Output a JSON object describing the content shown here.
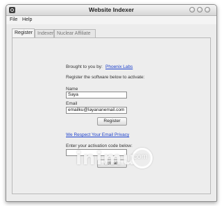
{
  "window": {
    "title": "Website Indexer"
  },
  "menu": {
    "items": [
      "File",
      "Help"
    ]
  },
  "tabs": [
    "Register",
    "Indexer",
    "Nuclear Affiliate"
  ],
  "register": {
    "brought_by_label": "Brought to you by:",
    "brought_by_link": "Phoenix Labs",
    "instructions": "Register the software below to activate:",
    "name_label": "Name",
    "name_value": "Saya",
    "email_label": "Email",
    "email_value": "emailku@layananemail.com",
    "register_button": "Register",
    "privacy_link": "We Respect Your Email Privacy",
    "activation_label": "Enter your activation code below:",
    "activation_value": "",
    "activate_button": "Activate"
  },
  "watermark": {
    "text": "inimu",
    "suffix": ".com"
  }
}
